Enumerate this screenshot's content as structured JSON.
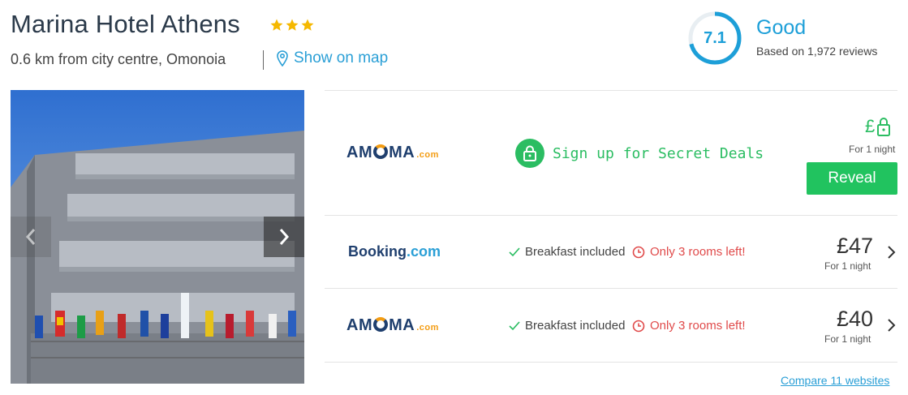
{
  "hotel": {
    "name": "Marina Hotel Athens",
    "star_count": 3,
    "location": "0.6 km from city centre, Omonoia",
    "map_link": "Show on map"
  },
  "rating": {
    "score": "7.1",
    "score_fraction": 0.71,
    "label": "Good",
    "reviews": "Based on 1,972 reviews"
  },
  "deals": {
    "secret_offer": {
      "provider": {
        "name": "AM",
        "name_end": "MA",
        "suffix": ".com"
      },
      "message": "Sign up for Secret Deals",
      "currency": "£",
      "per": "For 1 night",
      "button": "Reveal"
    },
    "offers": [
      {
        "provider": {
          "name": "Booking",
          "suffix": ".com"
        },
        "breakfast": "Breakfast included",
        "rooms": "Only 3 rooms left!",
        "price": "£47",
        "per": "For 1 night"
      },
      {
        "provider": {
          "name": "AM",
          "name_end": "MA",
          "suffix": ".com"
        },
        "breakfast": "Breakfast included",
        "rooms": "Only 3 rooms left!",
        "price": "£40",
        "per": "For 1 night"
      }
    ],
    "compare": "Compare 11 websites"
  },
  "colors": {
    "accent": "#1d9fd8",
    "green": "#21c35f",
    "warning": "#e04a4a",
    "star": "#f5b800"
  }
}
